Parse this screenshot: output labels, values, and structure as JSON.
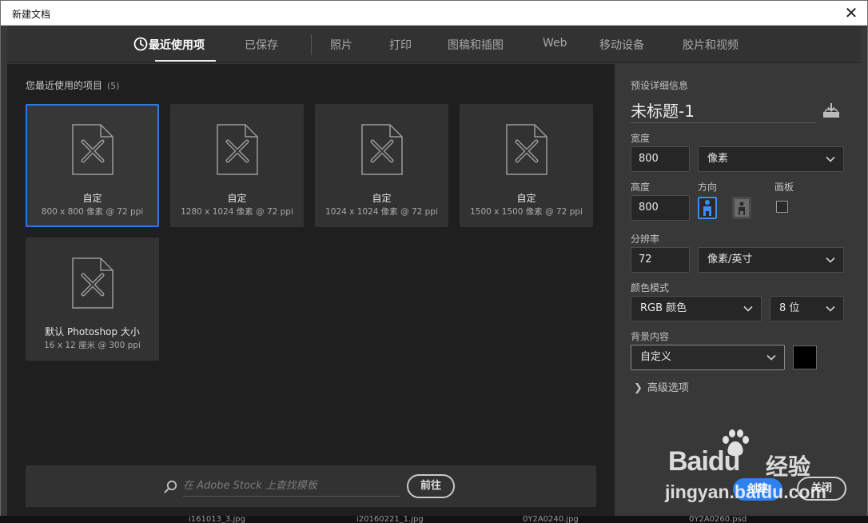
{
  "window": {
    "title": "新建文档",
    "close_glyph": "✕"
  },
  "tabs": [
    {
      "label": "最近使用项",
      "active": true,
      "icon": "clock-icon"
    },
    {
      "label": "已保存"
    },
    {
      "label": "照片"
    },
    {
      "label": "打印"
    },
    {
      "label": "图稿和插图"
    },
    {
      "label": "Web"
    },
    {
      "label": "移动设备"
    },
    {
      "label": "胶片和视频"
    }
  ],
  "recent": {
    "heading": "您最近使用的项目",
    "count": "(5)",
    "items": [
      {
        "name": "自定",
        "size": "800 x 800 像素 @ 72 ppi",
        "selected": true
      },
      {
        "name": "自定",
        "size": "1280 x 1024 像素 @ 72 ppi"
      },
      {
        "name": "自定",
        "size": "1024 x 1024 像素 @ 72 ppi"
      },
      {
        "name": "自定",
        "size": "1500 x 1500 像素 @ 72 ppi"
      },
      {
        "name": "默认 Photoshop 大小",
        "size": "16 x 12 厘米 @ 300 ppi"
      }
    ]
  },
  "search": {
    "placeholder": "在 Adobe Stock 上查找模板",
    "go_label": "前往"
  },
  "preset": {
    "heading": "预设详细信息",
    "doc_name": "未标题-1",
    "width_label": "宽度",
    "width_value": "800",
    "width_unit": "像素",
    "height_label": "高度",
    "height_value": "800",
    "orientation_label": "方向",
    "artboard_label": "画板",
    "artboard_checked": false,
    "resolution_label": "分辨率",
    "resolution_value": "72",
    "resolution_unit": "像素/英寸",
    "color_mode_label": "颜色模式",
    "color_mode": "RGB 颜色",
    "bit_depth": "8 位",
    "background_label": "背景内容",
    "background_value": "自定义",
    "background_color": "#000000",
    "advanced_label": "高级选项"
  },
  "actions": {
    "create_label": "创建",
    "close_label": "关闭"
  },
  "desktop_files": [
    "i161013_3.jpg",
    "i20160221_1.jpg",
    "0Y2A0240.jpg",
    "0Y2A0260.psd"
  ],
  "watermark": {
    "brand": "Baidu",
    "product": "经验",
    "url": "jingyan.baidu.com"
  },
  "colors": {
    "accent": "#2d80f0",
    "selected_border": "#2d7be0",
    "panel_dark": "#1f1f1f",
    "panel": "#383838"
  }
}
